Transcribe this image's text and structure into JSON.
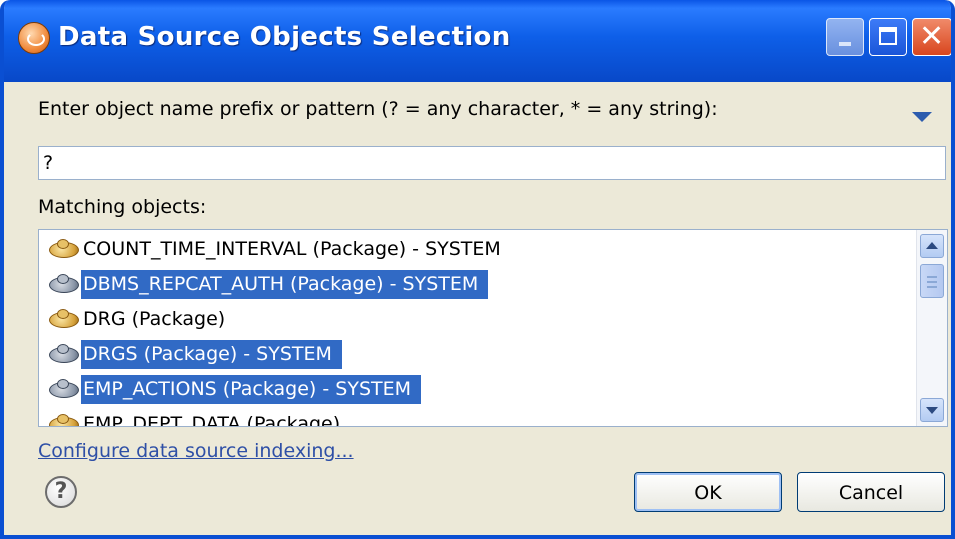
{
  "window": {
    "title": "Data Source Objects Selection",
    "icon": "app-icon",
    "controls": [
      "minimize-icon",
      "maximize-icon",
      "close-icon"
    ]
  },
  "prompt": {
    "label": "Enter object name prefix or pattern (? = any character, * = any string):"
  },
  "pattern_input": {
    "value": "?"
  },
  "matching": {
    "label": "Matching objects:",
    "items": [
      {
        "label": "COUNT_TIME_INTERVAL (Package) - SYSTEM",
        "selected": false
      },
      {
        "label": "DBMS_REPCAT_AUTH (Package) - SYSTEM",
        "selected": true
      },
      {
        "label": "DRG (Package)",
        "selected": false
      },
      {
        "label": "DRGS (Package) - SYSTEM",
        "selected": true
      },
      {
        "label": "EMP_ACTIONS (Package) - SYSTEM",
        "selected": true
      },
      {
        "label": "EMP_DEPT_DATA (Package)",
        "selected": false
      }
    ]
  },
  "footer": {
    "configure_link": "Configure data source indexing...",
    "ok_label": "OK",
    "cancel_label": "Cancel"
  },
  "colors": {
    "titlebar": "#0a55e6",
    "selection": "#316ac5",
    "dialog_bg": "#ece9d8",
    "link": "#2e4fa6"
  }
}
